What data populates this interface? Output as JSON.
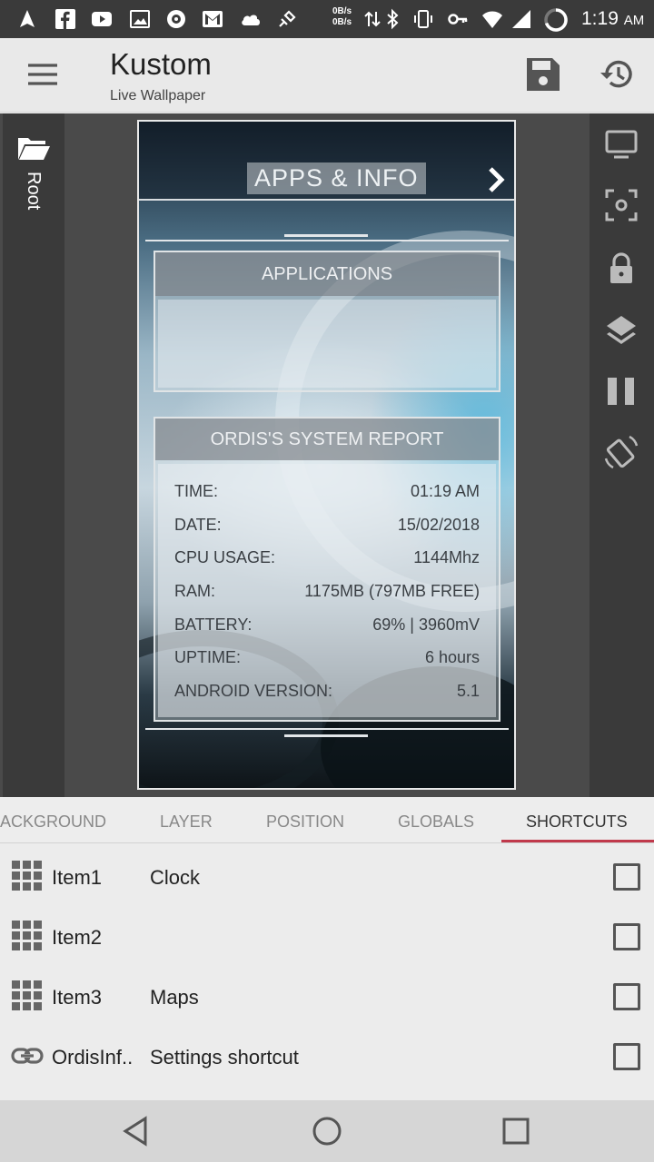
{
  "status_bar": {
    "network_rate_up": "0B/s",
    "network_rate_down": "0B/s",
    "time": "1:19",
    "ampm": "AM",
    "icons": [
      "navigation-icon",
      "facebook-icon",
      "youtube-icon",
      "image-icon",
      "camera-aperture-icon",
      "gmail-icon",
      "cloud-icon",
      "satellite-icon",
      "data-arrows-icon",
      "bluetooth-icon",
      "vibrate-icon",
      "key-icon",
      "wifi-icon",
      "signal-icon",
      "battery-ring-icon"
    ]
  },
  "app_bar": {
    "title": "Kustom",
    "subtitle": "Live Wallpaper",
    "icons": [
      "menu-icon",
      "save-icon",
      "history-icon"
    ]
  },
  "editor": {
    "left_rail_label": "Root",
    "right_rail_icons": [
      "monitor-icon",
      "screenshot-icon",
      "lock-icon",
      "layers-icon",
      "pause-icon",
      "rotate-icon"
    ],
    "preview": {
      "header_title": "APPS & INFO",
      "applications_title": "APPLICATIONS",
      "report_title": "ORDIS'S SYSTEM REPORT",
      "report_rows": [
        {
          "label": "TIME:",
          "value": "01:19 AM"
        },
        {
          "label": "DATE:",
          "value": "15/02/2018"
        },
        {
          "label": "CPU USAGE:",
          "value": "1144Mhz"
        },
        {
          "label": "RAM:",
          "value": "1175MB (797MB FREE)"
        },
        {
          "label": "BATTERY:",
          "value": "69% | 3960mV"
        },
        {
          "label": "UPTIME:",
          "value": "6 hours"
        },
        {
          "label": "ANDROID VERSION:",
          "value": "5.1"
        }
      ]
    }
  },
  "tabs": {
    "items": [
      "ACKGROUND",
      "LAYER",
      "POSITION",
      "GLOBALS",
      "SHORTCUTS"
    ],
    "active": "SHORTCUTS",
    "accent_color": "#c0394b"
  },
  "shortcuts": [
    {
      "name": "Item1",
      "value": "Clock",
      "icon": "grid-icon",
      "checked": false
    },
    {
      "name": "Item2",
      "value": "",
      "icon": "grid-icon",
      "checked": false
    },
    {
      "name": "Item3",
      "value": "Maps",
      "icon": "grid-icon",
      "checked": false
    },
    {
      "name": "OrdisInf..",
      "value": "Settings shortcut",
      "icon": "link-icon",
      "checked": false
    }
  ],
  "nav_bar": {
    "icons": [
      "back-icon",
      "home-icon",
      "recents-icon"
    ]
  }
}
